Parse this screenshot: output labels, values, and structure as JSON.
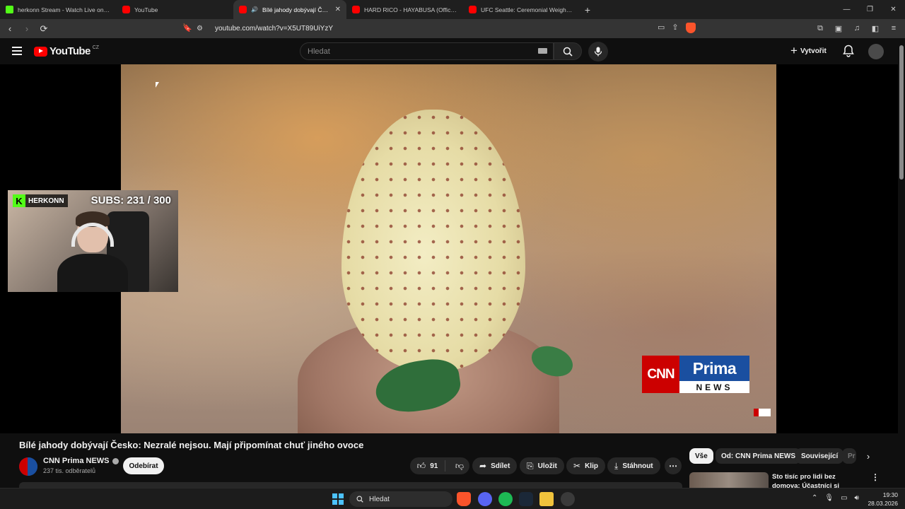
{
  "browser": {
    "tabs": [
      {
        "title": "herkonn Stream - Watch Live on Kick",
        "favicon": "kick-icon",
        "active": false
      },
      {
        "title": "YouTube",
        "favicon": "youtube-icon",
        "active": false
      },
      {
        "title": "Bílé jahody dobývají Česko: N",
        "favicon": "youtube-icon",
        "active": true
      },
      {
        "title": "HARD RICO - HAYABUSA (Official Vid",
        "favicon": "youtube-icon",
        "active": false
      },
      {
        "title": "UFC Seattle: Ceremonial Weigh-In - Y",
        "favicon": "youtube-icon",
        "active": false
      }
    ],
    "new_tab": "+",
    "url": "youtube.com/watch?v=X5UT89UiYzY",
    "window_controls": {
      "minimize": "—",
      "restore": "❐",
      "close": "✕"
    }
  },
  "youtube": {
    "logo_text": "YouTube",
    "country_code": "CZ",
    "search_placeholder": "Hledat",
    "create_label": "Vytvořit"
  },
  "video": {
    "overlay": {
      "streamer": "HERKONN",
      "subs": "SUBS: 231 / 300"
    },
    "watermark": {
      "cnn": "CNN",
      "prima": "Prima",
      "news": "NEWS"
    }
  },
  "watch": {
    "title": "Bílé jahody dobývají Česko: Nezralé nejsou. Mají připomínat chuť jiného ovoce",
    "channel": {
      "name": "CNN Prima NEWS",
      "subscribers": "237 tis. odběratelů"
    },
    "subscribe_label": "Odebírat",
    "likes": "91",
    "actions": {
      "share": "Sdílet",
      "save": "Uložit",
      "clip": "Klip",
      "download": "Stáhnout"
    }
  },
  "sidebar": {
    "chips": [
      "Vše",
      "Od: CNN Prima NEWS",
      "Související",
      "Pr"
    ],
    "recommendation": {
      "title": "Sto tisíc pro lidi bez domova: Účastníci si projekt chválí. Co"
    }
  },
  "taskbar": {
    "search_label": "Hledat",
    "time": "19:30",
    "date": "28.03.2026"
  }
}
